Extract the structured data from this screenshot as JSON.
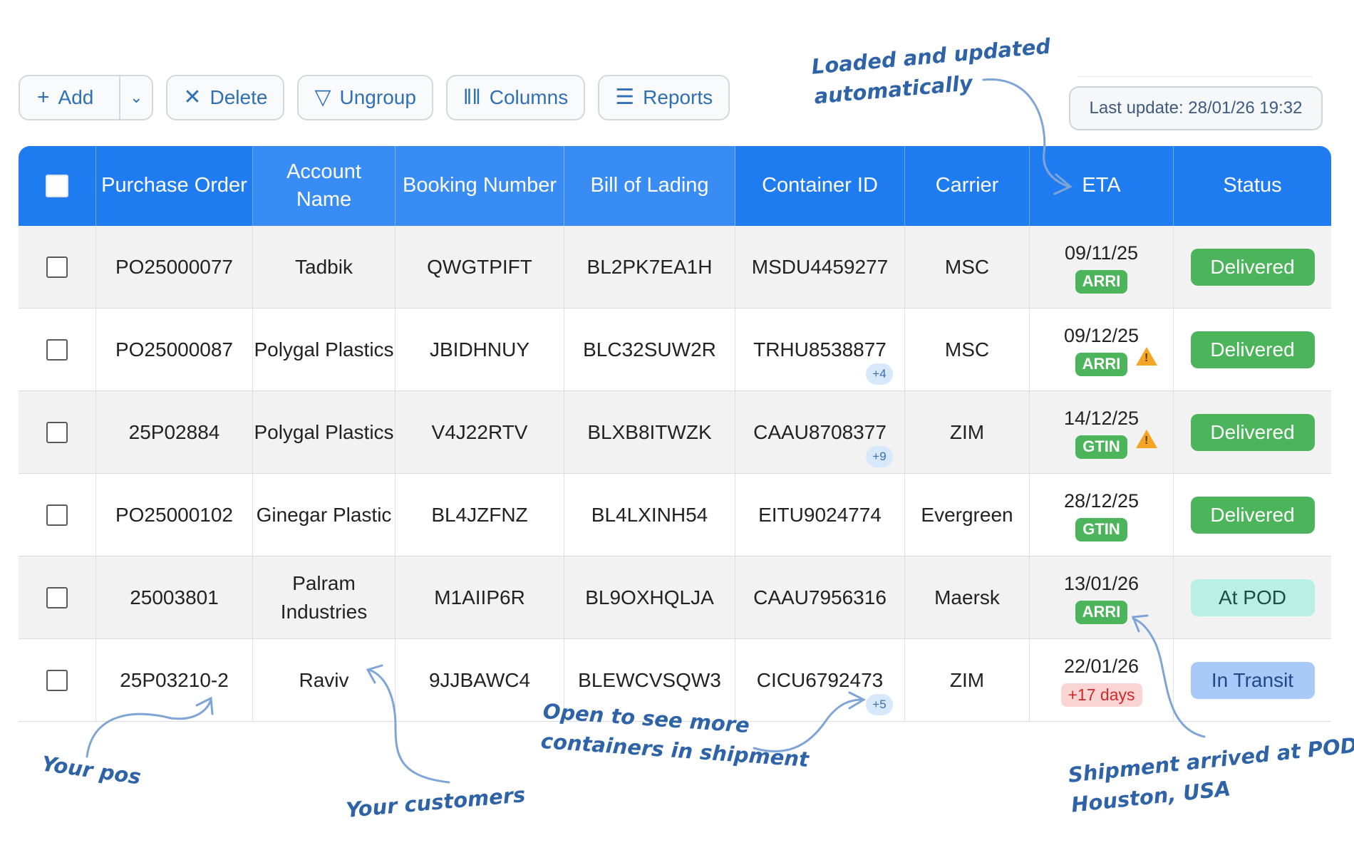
{
  "toolbar": {
    "add_label": "Add",
    "delete_label": "Delete",
    "ungroup_label": "Ungroup",
    "columns_label": "Columns",
    "reports_label": "Reports"
  },
  "last_update": "Last update: 28/01/26 19:32",
  "table": {
    "columns": [
      "Purchase Order",
      "Account Name",
      "Booking Number",
      "Bill of Lading",
      "Container ID",
      "Carrier",
      "ETA",
      "Status"
    ],
    "rows": [
      {
        "po": "PO25000077",
        "account": "Tadbik",
        "booking": "QWGTPIFT",
        "bol": "BL2PK7EA1H",
        "container": "MSDU4459277",
        "more": "",
        "carrier": "MSC",
        "eta": "09/11/25",
        "eta_tag": "ARRI",
        "warning": false,
        "status": "Delivered"
      },
      {
        "po": "PO25000087",
        "account": "Polygal Plastics",
        "booking": "JBIDHNUY",
        "bol": "BLC32SUW2R",
        "container": "TRHU8538877",
        "more": "+4",
        "carrier": "MSC",
        "eta": "09/12/25",
        "eta_tag": "ARRI",
        "warning": true,
        "status": "Delivered"
      },
      {
        "po": "25P02884",
        "account": "Polygal Plastics",
        "booking": "V4J22RTV",
        "bol": "BLXB8ITWZK",
        "container": "CAAU8708377",
        "more": "+9",
        "carrier": "ZIM",
        "eta": "14/12/25",
        "eta_tag": "GTIN",
        "warning": true,
        "status": "Delivered"
      },
      {
        "po": "PO25000102",
        "account": "Ginegar Plastic",
        "booking": "BL4JZFNZ",
        "bol": "BL4LXINH54",
        "container": "EITU9024774",
        "more": "",
        "carrier": "Evergreen",
        "eta": "28/12/25",
        "eta_tag": "GTIN",
        "warning": false,
        "status": "Delivered"
      },
      {
        "po": "25003801",
        "account": "Palram Industries",
        "booking": "M1AIIP6R",
        "bol": "BL9OXHQLJA",
        "container": "CAAU7956316",
        "more": "",
        "carrier": "Maersk",
        "eta": "13/01/26",
        "eta_tag": "ARRI",
        "warning": false,
        "status": "At POD"
      },
      {
        "po": "25P03210-2",
        "account": "Raviv",
        "booking": "9JJBAWC4",
        "bol": "BLEWCVSQW3",
        "container": "CICU6792473",
        "more": "+5",
        "carrier": "ZIM",
        "eta": "22/01/26",
        "eta_tag": "+17 days",
        "warning": false,
        "status": "In Transit"
      }
    ]
  },
  "annotations": {
    "loaded": [
      "Loaded and updated",
      "automatically"
    ],
    "your_pos": "Your pos",
    "your_customers": "Your customers",
    "open_more": [
      "Open to see more",
      "containers in shipment"
    ],
    "arrived": [
      "Shipment arrived at POD,",
      "Houston, USA"
    ]
  },
  "colors": {
    "header_bg": "#1f7cf0",
    "delivered": "#4cb45a",
    "at_pod": "#b9f0e6",
    "in_transit": "#a9c9f8",
    "annotation": "#2e63a8"
  }
}
